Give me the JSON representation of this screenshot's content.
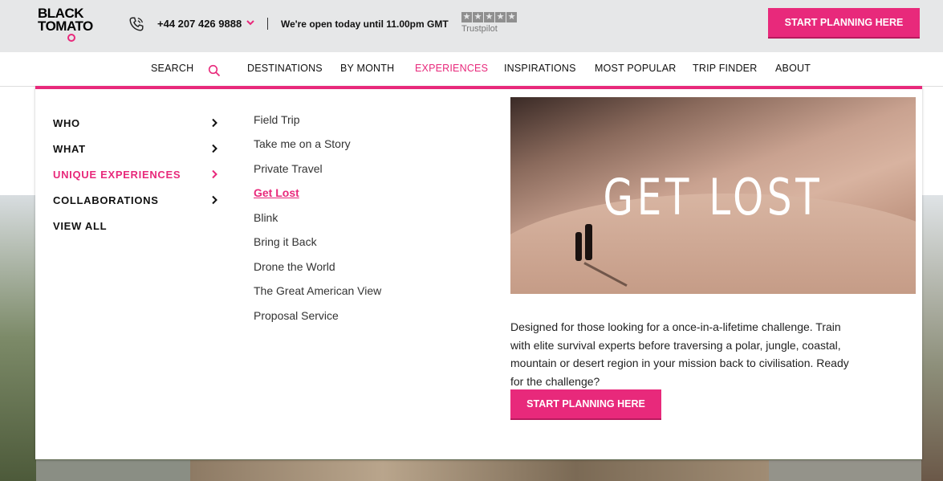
{
  "header": {
    "logo_text": [
      "BLACK",
      "TOMATO"
    ],
    "phone": "+44 207 426 9888",
    "opening_hours": "We're open today until 11.00pm GMT",
    "trustpilot_label": "Trustpilot",
    "cta_label": "START PLANNING HERE"
  },
  "nav": {
    "items": [
      {
        "label": "SEARCH"
      },
      {
        "label": "DESTINATIONS"
      },
      {
        "label": "BY MONTH"
      },
      {
        "label": "EXPERIENCES"
      },
      {
        "label": "INSPIRATIONS"
      },
      {
        "label": "MOST POPULAR"
      },
      {
        "label": "TRIP FINDER"
      },
      {
        "label": "ABOUT"
      }
    ],
    "active": "EXPERIENCES"
  },
  "menu": {
    "categories": [
      {
        "label": "WHO"
      },
      {
        "label": "WHAT"
      },
      {
        "label": "UNIQUE EXPERIENCES"
      },
      {
        "label": "COLLABORATIONS"
      },
      {
        "label": "VIEW ALL"
      }
    ],
    "active_category": "UNIQUE EXPERIENCES",
    "subitems": [
      {
        "label": "Field Trip"
      },
      {
        "label": "Take me on a Story"
      },
      {
        "label": "Private Travel"
      },
      {
        "label": "Get Lost"
      },
      {
        "label": "Blink"
      },
      {
        "label": "Bring it Back"
      },
      {
        "label": "Drone the World"
      },
      {
        "label": "The Great American View"
      },
      {
        "label": "Proposal Service"
      }
    ],
    "active_subitem": "Get Lost"
  },
  "promo": {
    "image_title": "GET LOST",
    "description": "Designed for those looking for a once-in-a-lifetime challenge. Train with elite survival experts before traversing a polar, jungle, coastal, mountain or desert region in your mission back to civilisation. Ready for the challenge?",
    "cta_label": "START PLANNING HERE"
  },
  "colors": {
    "accent": "#e8297b",
    "topbar_bg": "#e6e7e8"
  }
}
